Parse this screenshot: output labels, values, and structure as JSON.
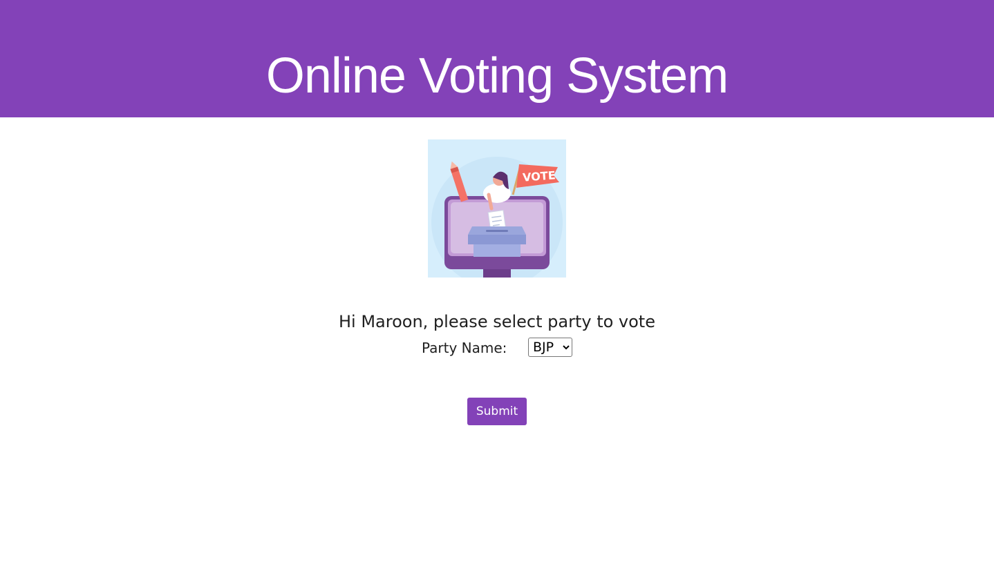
{
  "header": {
    "title": "Online Voting System",
    "background_color": "#8342b8"
  },
  "hero_image": {
    "icon": "vote-illustration",
    "flag_text": "VOTE"
  },
  "vote_form": {
    "greeting": "Hi Maroon, please select party to vote",
    "party_label": "Party Name:",
    "party_selected": "BJP",
    "party_options": [
      "BJP"
    ],
    "submit_label": "Submit",
    "accent_color": "#8342b8"
  }
}
